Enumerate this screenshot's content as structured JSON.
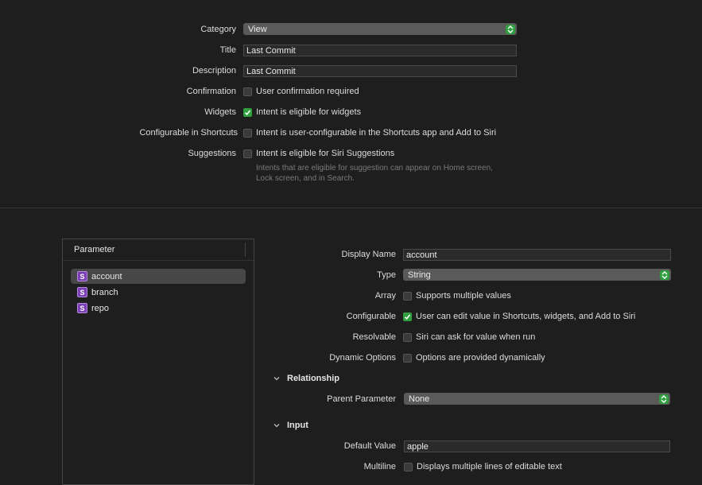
{
  "intent": {
    "category": {
      "label": "Category",
      "value": "View"
    },
    "title": {
      "label": "Title",
      "value": "Last Commit"
    },
    "description": {
      "label": "Description",
      "value": "Last Commit"
    },
    "confirmation": {
      "label": "Confirmation",
      "text": "User confirmation required",
      "checked": false
    },
    "widgets": {
      "label": "Widgets",
      "text": "Intent is eligible for widgets",
      "checked": true
    },
    "configurable_shortcuts": {
      "label": "Configurable in Shortcuts",
      "text": "Intent is user-configurable in the Shortcuts app and Add to Siri",
      "checked": false
    },
    "suggestions": {
      "label": "Suggestions",
      "text": "Intent is eligible for Siri Suggestions",
      "checked": false
    },
    "suggestions_hint_line1": "Intents that are eligible for suggestion can appear on Home screen,",
    "suggestions_hint_line2": "Lock screen, and in Search."
  },
  "parameters": {
    "header": "Parameter",
    "badge": "S",
    "items": [
      {
        "name": "account",
        "selected": true
      },
      {
        "name": "branch",
        "selected": false
      },
      {
        "name": "repo",
        "selected": false
      }
    ]
  },
  "detail": {
    "display_name": {
      "label": "Display Name",
      "value": "account"
    },
    "type": {
      "label": "Type",
      "value": "String"
    },
    "array": {
      "label": "Array",
      "text": "Supports multiple values",
      "checked": false
    },
    "configurable": {
      "label": "Configurable",
      "text": "User can edit value in Shortcuts, widgets, and Add to Siri",
      "checked": true
    },
    "resolvable": {
      "label": "Resolvable",
      "text": "Siri can ask for value when run",
      "checked": false
    },
    "dynamic_options": {
      "label": "Dynamic Options",
      "text": "Options are provided dynamically",
      "checked": false
    },
    "relationship_section": "Relationship",
    "parent_parameter": {
      "label": "Parent Parameter",
      "value": "None"
    },
    "input_section": "Input",
    "default_value": {
      "label": "Default Value",
      "value": "apple"
    },
    "multiline": {
      "label": "Multiline",
      "text": "Displays multiple lines of editable text",
      "checked": false
    }
  },
  "colors": {
    "accent": "#2f9f3f",
    "background": "#1e1e1e",
    "badge": "#7b3fb5"
  }
}
